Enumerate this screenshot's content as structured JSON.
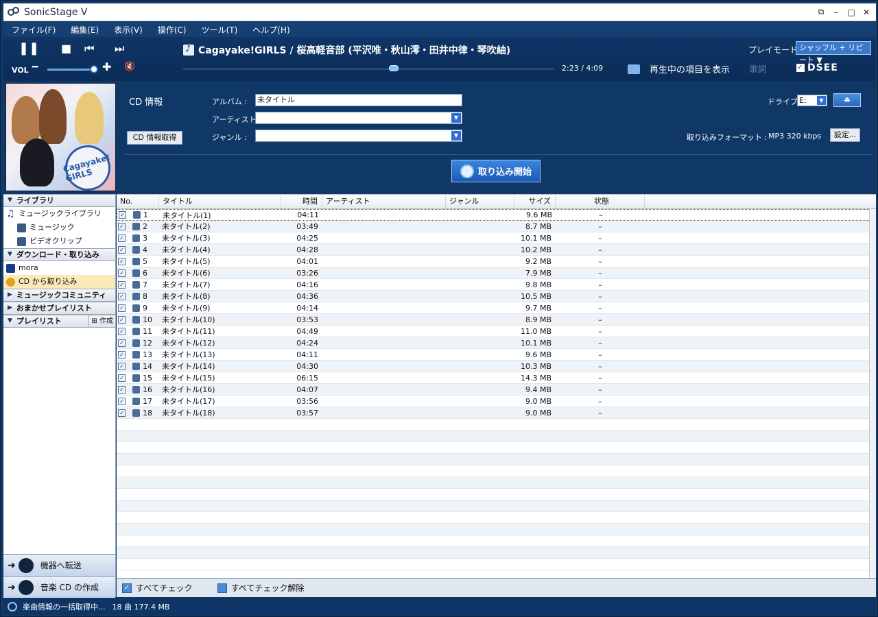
{
  "window": {
    "title": "SonicStage V"
  },
  "menu": [
    "ファイル(F)",
    "編集(E)",
    "表示(V)",
    "操作(C)",
    "ツール(T)",
    "ヘルプ(H)"
  ],
  "player": {
    "now_playing": "Cagayake!GIRLS / 桜高軽音部 (平沢唯・秋山澪・田井中律・琴吹紬)",
    "playmode_label": "プレイモード",
    "playmode_value": "シャッフル + リピート ▼",
    "vol_label": "VOL",
    "time": "2:23 / 4:09",
    "show_playing": "再生中の項目を表示",
    "lyrics": "歌詞",
    "dsee": "DSEE"
  },
  "cd_info": {
    "title": "CD 情報",
    "fetch_button": "CD 情報取得",
    "album_label": "アルバム :",
    "album_value": "未タイトル",
    "artist_label": "アーティスト :",
    "artist_value": "",
    "genre_label": "ジャンル :",
    "genre_value": "",
    "drive_label": "ドライブ :",
    "drive_value": "E:",
    "format_label": "取り込みフォーマット :",
    "format_value": "MP3 320 kbps",
    "settings_button": "設定...",
    "rip_button": "取り込み開始",
    "album_art_text": "Cagayake! GIRLS"
  },
  "sidebar": {
    "library_head": "ライブラリ",
    "music_library": "ミュージックライブラリ",
    "music": "ミュージック",
    "video": "ビデオクリップ",
    "download_head": "ダウンロード・取り込み",
    "mora": "mora",
    "cd_import": "CD から取り込み",
    "community_head": "ミュージックコミュニティ",
    "omakase_head": "おまかせプレイリスト",
    "playlist_head": "プレイリスト",
    "create": "作成",
    "transfer": "機器へ転送",
    "make_cd": "音楽 CD の作成"
  },
  "columns": [
    "No.",
    "タイトル",
    "時間",
    "アーティスト",
    "ジャンル",
    "サイズ",
    "状態"
  ],
  "tracks": [
    {
      "no": "1",
      "title": "未タイトル(1)",
      "time": "04:11",
      "size": "9.6 MB",
      "status": "–"
    },
    {
      "no": "2",
      "title": "未タイトル(2)",
      "time": "03:49",
      "size": "8.7 MB",
      "status": "–"
    },
    {
      "no": "3",
      "title": "未タイトル(3)",
      "time": "04:25",
      "size": "10.1 MB",
      "status": "–"
    },
    {
      "no": "4",
      "title": "未タイトル(4)",
      "time": "04:28",
      "size": "10.2 MB",
      "status": "–"
    },
    {
      "no": "5",
      "title": "未タイトル(5)",
      "time": "04:01",
      "size": "9.2 MB",
      "status": "–"
    },
    {
      "no": "6",
      "title": "未タイトル(6)",
      "time": "03:26",
      "size": "7.9 MB",
      "status": "–"
    },
    {
      "no": "7",
      "title": "未タイトル(7)",
      "time": "04:16",
      "size": "9.8 MB",
      "status": "–"
    },
    {
      "no": "8",
      "title": "未タイトル(8)",
      "time": "04:36",
      "size": "10.5 MB",
      "status": "–"
    },
    {
      "no": "9",
      "title": "未タイトル(9)",
      "time": "04:14",
      "size": "9.7 MB",
      "status": "–"
    },
    {
      "no": "10",
      "title": "未タイトル(10)",
      "time": "03:53",
      "size": "8.9 MB",
      "status": "–"
    },
    {
      "no": "11",
      "title": "未タイトル(11)",
      "time": "04:49",
      "size": "11.0 MB",
      "status": "–"
    },
    {
      "no": "12",
      "title": "未タイトル(12)",
      "time": "04:24",
      "size": "10.1 MB",
      "status": "–"
    },
    {
      "no": "13",
      "title": "未タイトル(13)",
      "time": "04:11",
      "size": "9.6 MB",
      "status": "–"
    },
    {
      "no": "14",
      "title": "未タイトル(14)",
      "time": "04:30",
      "size": "10.3 MB",
      "status": "–"
    },
    {
      "no": "15",
      "title": "未タイトル(15)",
      "time": "06:15",
      "size": "14.3 MB",
      "status": "–"
    },
    {
      "no": "16",
      "title": "未タイトル(16)",
      "time": "04:07",
      "size": "9.4 MB",
      "status": "–"
    },
    {
      "no": "17",
      "title": "未タイトル(17)",
      "time": "03:56",
      "size": "9.0 MB",
      "status": "–"
    },
    {
      "no": "18",
      "title": "未タイトル(18)",
      "time": "03:57",
      "size": "9.0 MB",
      "status": "–"
    }
  ],
  "checkbar": {
    "check_all": "すべてチェック",
    "uncheck_all": "すべてチェック解除"
  },
  "status": {
    "text": "楽曲情報の一括取得中...",
    "summary": "18 曲 177.4 MB"
  }
}
